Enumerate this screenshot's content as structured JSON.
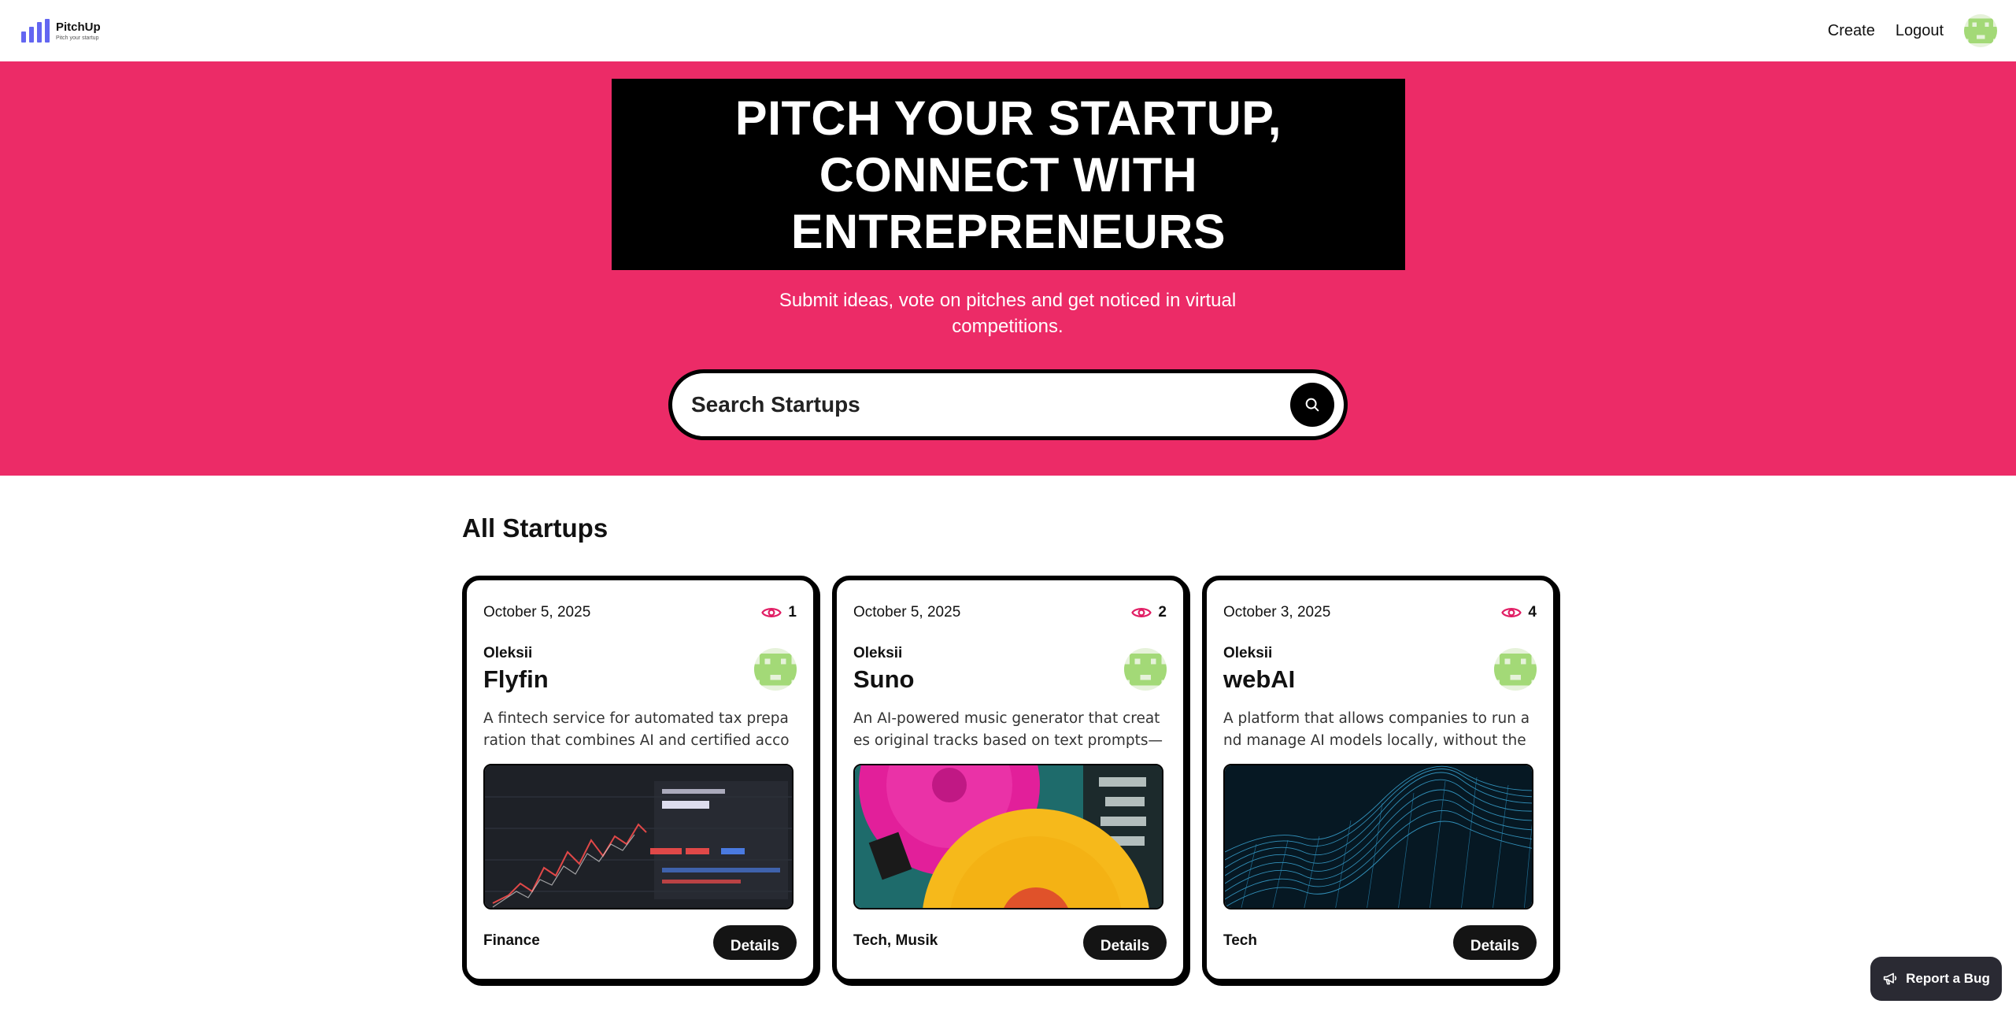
{
  "nav": {
    "brand_name": "PitchUp",
    "brand_tagline": "Pitch your startup",
    "links": [
      {
        "label": "Create"
      },
      {
        "label": "Logout"
      }
    ],
    "avatar_icon": "pixel-avatar-icon"
  },
  "hero": {
    "title_lines": [
      "PITCH YOUR STARTUP,",
      "CONNECT WITH",
      "ENTREPRENEURS"
    ],
    "subtitle": "Submit ideas, vote on pitches and get noticed in virtual competitions.",
    "search_placeholder": "Search Startups",
    "bg_color": "#ec2b67"
  },
  "section": {
    "title": "All Startups"
  },
  "startups": [
    {
      "date": "October 5, 2025",
      "views": "1",
      "author": "Oleksii",
      "title": "Flyfin",
      "description": "A fintech service for automated tax preparation that combines AI and certified accou...",
      "category": "Finance",
      "details_label": "Details",
      "image_icon": "stock-chart-image"
    },
    {
      "date": "October 5, 2025",
      "views": "2",
      "author": "Oleksii",
      "title": "Suno",
      "description": "An AI-powered music generator that creates original tracks based on text prompts—ide...",
      "category": "Tech, Musik",
      "details_label": "Details",
      "image_icon": "vinyl-records-image"
    },
    {
      "date": "October 3, 2025",
      "views": "4",
      "author": "Oleksii",
      "title": "webAI",
      "description": "A platform that allows companies to run and manage AI models locally, without the cl...",
      "category": "Tech",
      "details_label": "Details",
      "image_icon": "wireframe-terrain-image"
    }
  ],
  "report_bug": {
    "label": "Report a Bug"
  },
  "colors": {
    "accent": "#ec2b67",
    "eye_icon": "#e11d64",
    "avatar_green": "#a3d977"
  }
}
